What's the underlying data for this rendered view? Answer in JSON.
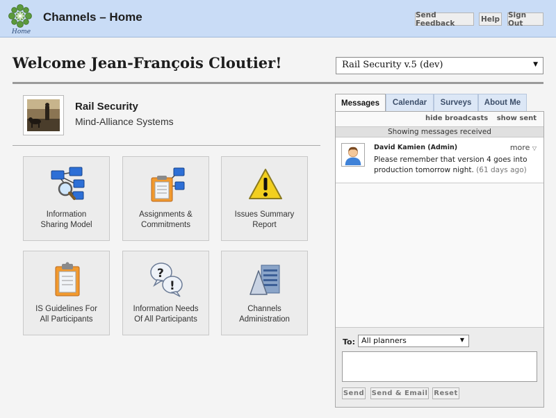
{
  "header": {
    "home_label": "Home",
    "title": "Channels – Home",
    "send_feedback": "Send Feedback",
    "help": "Help",
    "sign_out": "Sign Out"
  },
  "welcome": "Welcome Jean-François Cloutier!",
  "plan_selector": {
    "selected": "Rail Security v.5 (dev)"
  },
  "plan": {
    "name": "Rail Security",
    "organization": "Mind-Alliance Systems"
  },
  "tiles": [
    {
      "line1": "Information",
      "line2": "Sharing Model",
      "icon": "network-search-icon"
    },
    {
      "line1": "Assignments &",
      "line2": "Commitments",
      "icon": "assignments-icon"
    },
    {
      "line1": "Issues Summary",
      "line2": "Report",
      "icon": "warning-icon"
    },
    {
      "line1": "IS Guidelines For",
      "line2": "All Participants",
      "icon": "clipboard-icon"
    },
    {
      "line1": "Information Needs",
      "line2": "Of All Participants",
      "icon": "question-bubbles-icon"
    },
    {
      "line1": "Channels",
      "line2": "Administration",
      "icon": "server-icon"
    }
  ],
  "messages": {
    "tabs": [
      "Messages",
      "Calendar",
      "Surveys",
      "About Me"
    ],
    "hide_broadcasts": "hide broadcasts",
    "show_sent": "show sent",
    "showing": "Showing messages received",
    "items": [
      {
        "sender": "David Kamien (Admin)",
        "more": "more",
        "body": "Please remember that version 4 goes into production tomorrow night.",
        "ago": "(61 days ago)"
      }
    ],
    "compose": {
      "to_label": "To:",
      "to_selected": "All planners",
      "send": "Send",
      "send_email": "Send & Email",
      "reset": "Reset"
    }
  },
  "colors": {
    "header_bg": "#c9dcf6",
    "tab_bg": "#dce7f6",
    "warning": "#f2cf1f",
    "accent_blue": "#2d6fd6"
  }
}
